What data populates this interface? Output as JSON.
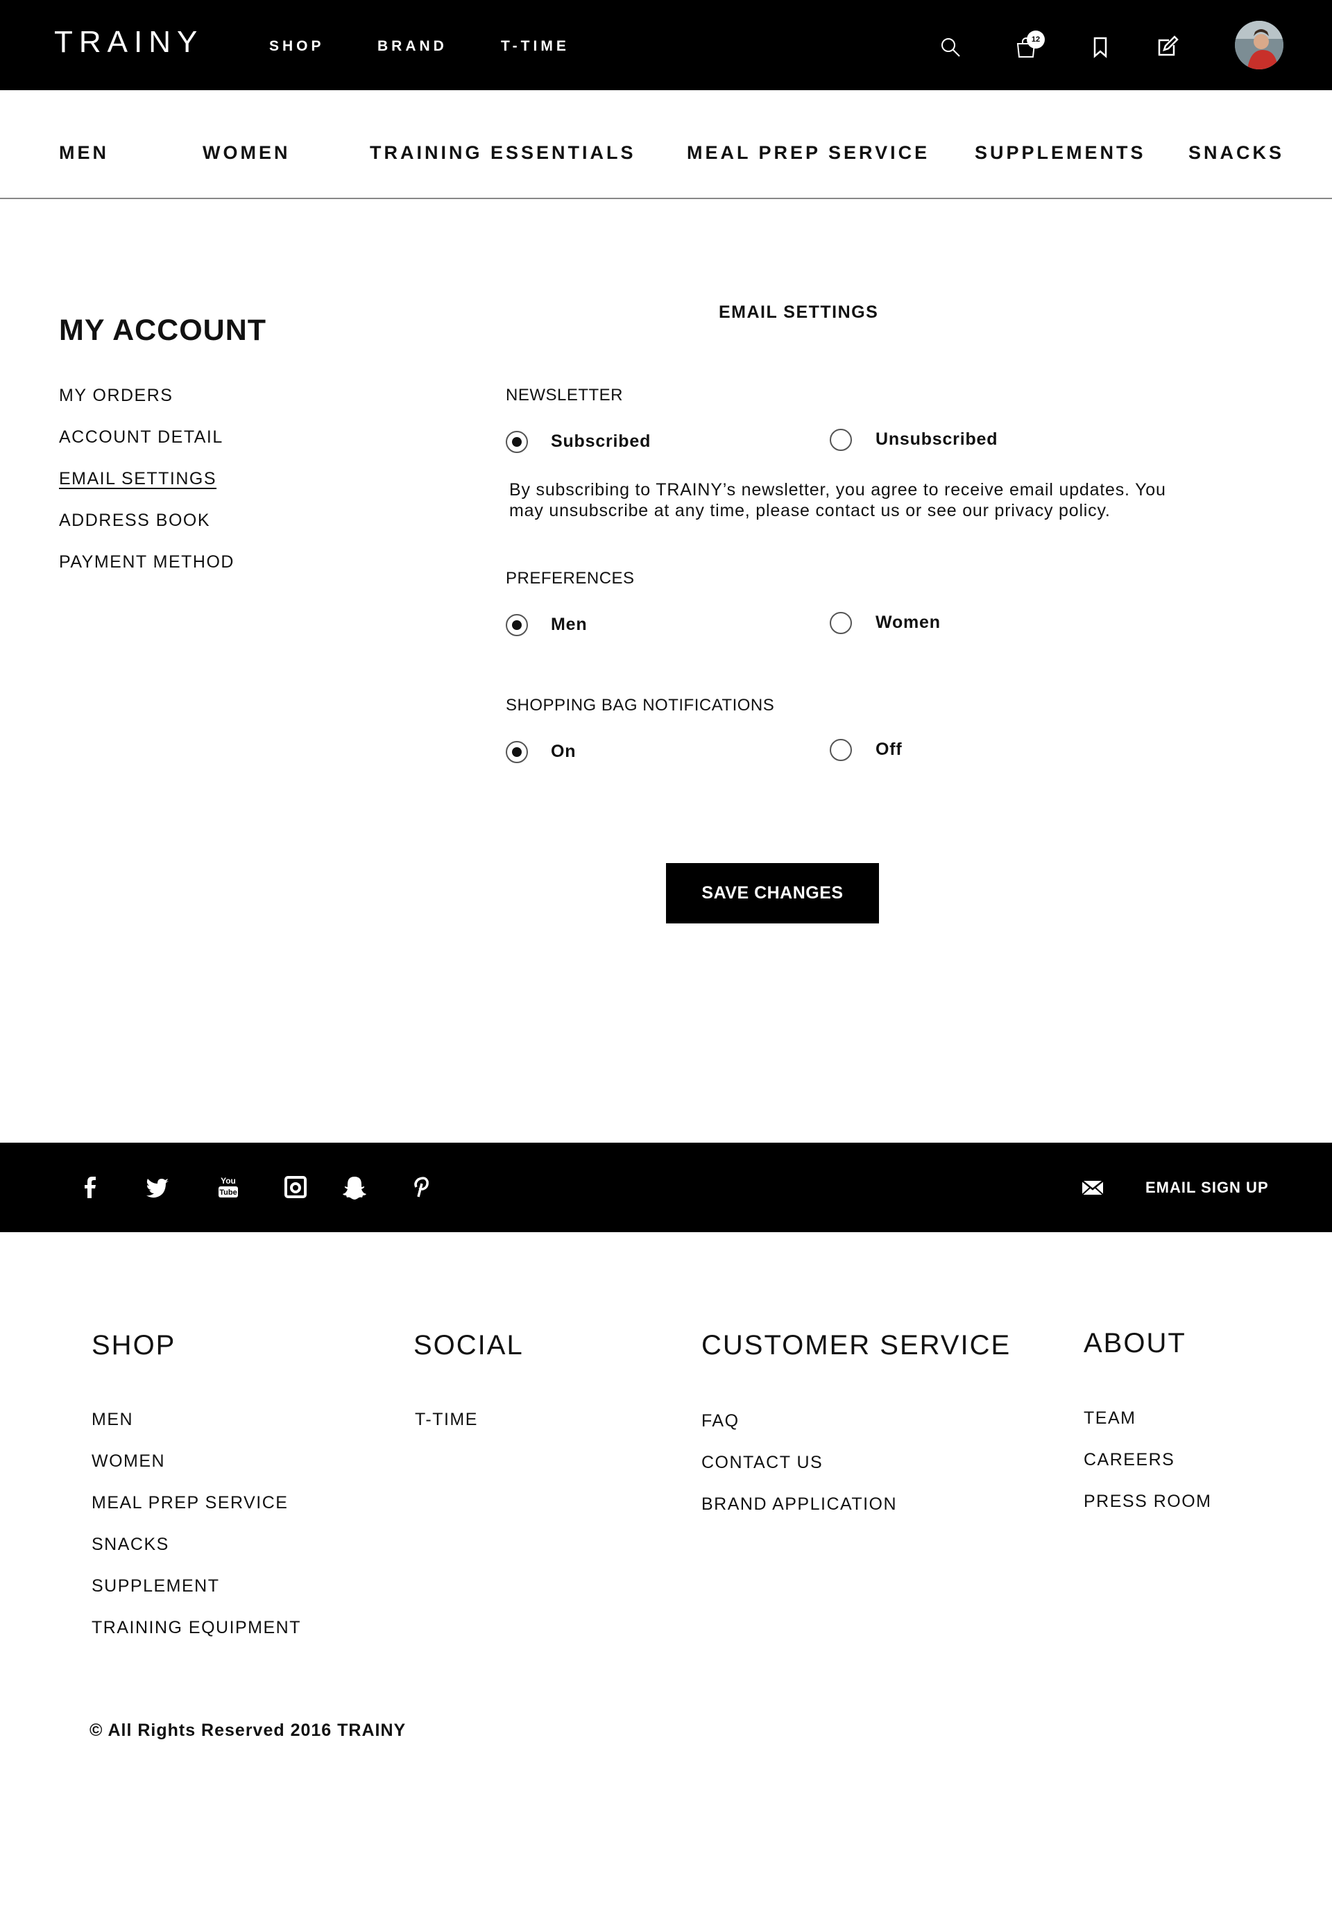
{
  "header": {
    "logo": "TRAINY",
    "nav": [
      "SHOP",
      "BRAND",
      "T-TIME"
    ],
    "cart_count": "12",
    "icons": [
      "search-icon",
      "shopping-bag-icon",
      "bookmark-icon",
      "edit-icon"
    ]
  },
  "categories": [
    "MEN",
    "WOMEN",
    "TRAINING ESSENTIALS",
    "MEAL PREP SERVICE",
    "SUPPLEMENTS",
    "SNACKS"
  ],
  "account": {
    "title": "MY ACCOUNT",
    "menu": [
      "MY ORDERS",
      "ACCOUNT DETAIL",
      "EMAIL SETTINGS",
      "ADDRESS BOOK",
      "PAYMENT METHOD"
    ],
    "active_item": "EMAIL SETTINGS"
  },
  "email_settings": {
    "title": "EMAIL SETTINGS",
    "newsletter": {
      "label": "NEWSLETTER",
      "options": [
        "Subscribed",
        "Unsubscribed"
      ],
      "selected": "Subscribed",
      "description": "By subscribing to TRAINY’s newsletter, you agree to receive email updates. You may unsubscribe at any time, please contact us or see our privacy policy."
    },
    "preferences": {
      "label": "PREFERENCES",
      "options": [
        "Men",
        "Women"
      ],
      "selected": "Men"
    },
    "bag_notifications": {
      "label": "SHOPPING BAG NOTIFICATIONS",
      "options": [
        "On",
        "Off"
      ],
      "selected": "On"
    },
    "save_label": "SAVE CHANGES"
  },
  "social_bar": {
    "icons": [
      "facebook-icon",
      "twitter-icon",
      "youtube-icon",
      "instagram-icon",
      "snapchat-icon",
      "pinterest-icon"
    ],
    "youtube_text": [
      "You",
      "Tube"
    ],
    "email_signup": "EMAIL SIGN UP"
  },
  "footer": {
    "columns": [
      {
        "title": "SHOP",
        "links": [
          "MEN",
          "WOMEN",
          "MEAL PREP SERVICE",
          "SNACKS",
          "SUPPLEMENT",
          "TRAINING EQUIPMENT"
        ]
      },
      {
        "title": "SOCIAL",
        "links": [
          "T-TIME"
        ]
      },
      {
        "title": "CUSTOMER SERVICE",
        "links": [
          "FAQ",
          "CONTACT US",
          "BRAND APPLICATION"
        ]
      },
      {
        "title": "ABOUT",
        "links": [
          "TEAM",
          "CAREERS",
          "PRESS ROOM"
        ]
      }
    ],
    "copyright": "© All Rights Reserved 2016 TRAINY"
  },
  "colors": {
    "bar_background": "#000000",
    "text": "#111111",
    "page_background": "#ffffff"
  }
}
